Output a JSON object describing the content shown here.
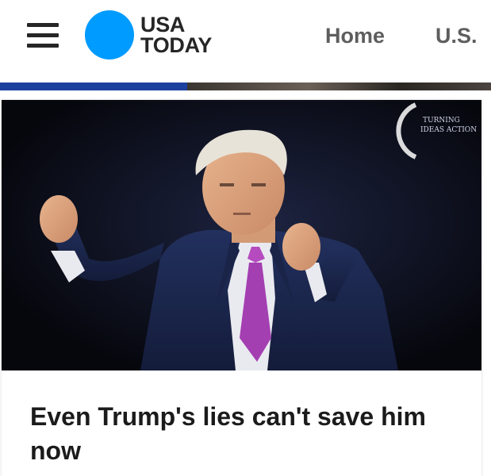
{
  "header": {
    "logo_line1": "USA",
    "logo_line2": "TODAY",
    "nav": [
      "Home",
      "U.S."
    ]
  },
  "colors": {
    "brand_blue": "#009bff",
    "text_dark": "#1b1b1b",
    "nav_gray": "#5e5e5e"
  },
  "article": {
    "headline": "Even Trump's lies can't save him now",
    "image_alt": "Donald Trump raising both fists on a dark stage"
  }
}
